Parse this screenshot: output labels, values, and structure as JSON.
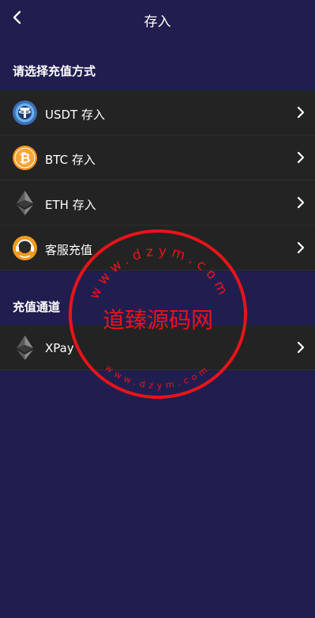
{
  "header": {
    "title": "存入"
  },
  "deposit_section": {
    "title": "请选择充值方式",
    "items": [
      {
        "label": "USDT 存入",
        "icon": "tether-icon"
      },
      {
        "label": "BTC 存入",
        "icon": "bitcoin-icon"
      },
      {
        "label": "ETH 存入",
        "icon": "ethereum-icon"
      },
      {
        "label": "客服充值",
        "icon": "customer-service-icon"
      }
    ]
  },
  "channel_section": {
    "title": "充值通道",
    "items": [
      {
        "label": "XPay",
        "icon": "ethereum-icon"
      }
    ]
  },
  "watermark": {
    "center_text": "道臻源码网",
    "ring_text_top": "www.dzym.com",
    "ring_text_bottom": "www.dzym.com"
  },
  "colors": {
    "background": "#201e4e",
    "row": "#232323",
    "watermark": "#e8141a",
    "bitcoin": "#f7931a",
    "tether": "#2b7fd1",
    "service": "#f39a1e"
  }
}
